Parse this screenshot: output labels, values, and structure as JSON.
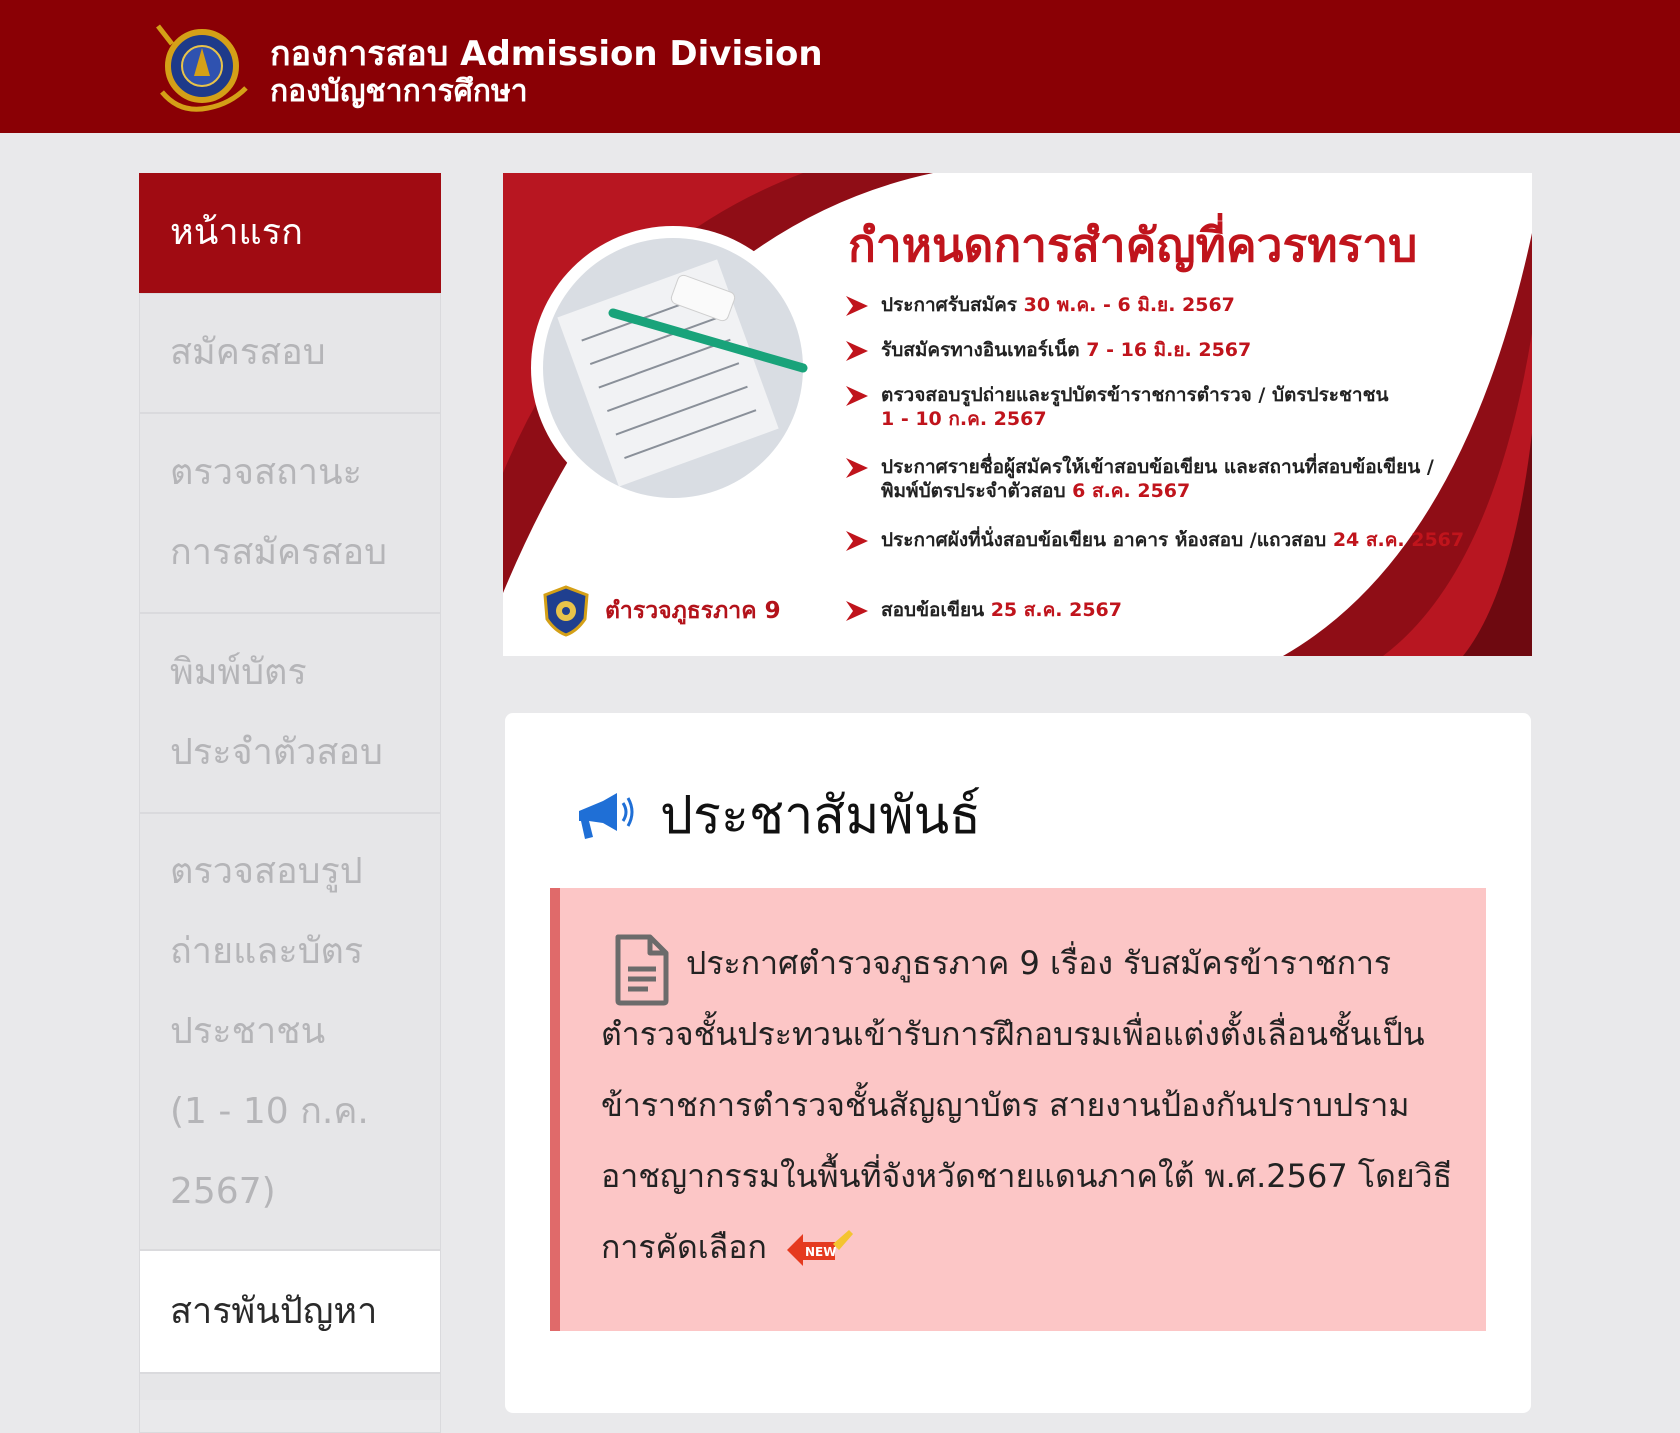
{
  "header": {
    "title_line1": "กองการสอบ Admission Division",
    "title_line2": "กองบัญชาการศึกษา"
  },
  "sidebar": {
    "items": [
      {
        "lines": [
          "หน้าแรก"
        ]
      },
      {
        "lines": [
          "สมัครสอบ"
        ]
      },
      {
        "lines": [
          "ตรวจสถานะ",
          "การสมัครสอบ"
        ]
      },
      {
        "lines": [
          "พิมพ์บัตร",
          "ประจำตัวสอบ"
        ]
      },
      {
        "lines": [
          "ตรวจสอบรูป",
          "ถ่ายและบัตร",
          "ประชาชน",
          "(1 - 10 ก.ค.",
          "2567)"
        ]
      },
      {
        "lines": [
          "สารพันปัญหา"
        ]
      }
    ]
  },
  "banner": {
    "title": "กำหนดการสำคัญที่ควรทราบ",
    "events": [
      {
        "text": "ประกาศรับสมัคร",
        "date": "30 พ.ค. - 6 มิ.ย. 2567"
      },
      {
        "text": "รับสมัครทางอินเทอร์เน็ต",
        "date": "7 - 16 มิ.ย. 2567"
      },
      {
        "text": "ตรวจสอบรูปถ่ายและรูปบัตรข้าราชการตำรวจ / บัตรประชาชน",
        "date": "1 - 10 ก.ค. 2567"
      },
      {
        "text": "ประกาศรายชื่อผู้สมัครให้เข้าสอบข้อเขียน และสถานที่สอบข้อเขียน / พิมพ์บัตรประจำตัวสอบ",
        "date": "6 ส.ค. 2567"
      },
      {
        "text": "ประกาศผังที่นั่งสอบข้อเขียน อาคาร ห้องสอบ /แถวสอบ",
        "date": "24 ส.ค. 2567"
      },
      {
        "text": "สอบข้อเขียน",
        "date": "25 ส.ค. 2567"
      }
    ],
    "agency": "ตำรวจภูธรภาค 9"
  },
  "announcements": {
    "title": "ประชาสัมพันธ์",
    "notice": "ประกาศตำรวจภูธรภาค 9 เรื่อง รับสมัครข้าราชการตำรวจชั้นประทวนเข้ารับการฝึกอบรมเพื่อแต่งตั้งเลื่อนชั้นเป็นข้าราชการตำรวจชั้นสัญญาบัตร สายงานป้องกันปราบปรามอาชญากรรมในพื้นที่จังหวัดชายแดนภาคใต้ พ.ศ.2567 โดยวิธีการคัดเลือก",
    "badge": "NEW"
  },
  "colors": {
    "header_bg": "#8a0005",
    "active_nav": "#a00b12",
    "accent_red": "#c0141c",
    "notice_bg": "#fcc6c6",
    "notice_border": "#e06a6a"
  }
}
